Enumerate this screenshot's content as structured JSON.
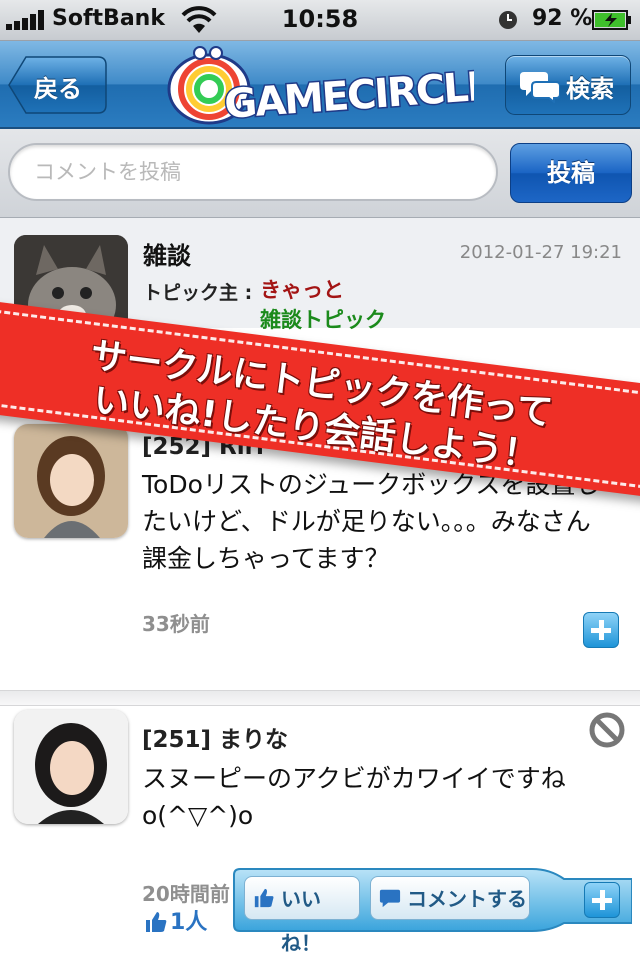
{
  "status_bar": {
    "carrier": "SoftBank",
    "time": "10:58",
    "battery": "92 %"
  },
  "nav": {
    "back_label": "戻る",
    "logo_text": "GAMECIRCLE",
    "search_label": "検索"
  },
  "composer": {
    "placeholder": "コメントを投稿",
    "post_label": "投稿"
  },
  "topic": {
    "title": "雑談",
    "date": "2012-01-27 19:21",
    "owner_label": "トピック主 :",
    "owner": "きゃっと",
    "category_suffix": ": 雑談トピック",
    "category": "雑談トピック"
  },
  "banner": {
    "line1": "サークルにトピックを作って",
    "line2": "いいね!したり会話しよう！"
  },
  "posts": [
    {
      "name": "[252] Riri",
      "body": "ToDoリストのジュークボックスを設置したいけど、ドルが足りない。。。みなさん課金しちゃってます？",
      "time": "33秒前"
    },
    {
      "name": "[251] まりな",
      "body": "スヌーピーのアクビがカワイイですねo(^▽^)o",
      "time": "20時間前",
      "likes": "1人"
    }
  ],
  "actions": {
    "like_label": "いいね！",
    "comment_label": "コメントする"
  },
  "colors": {
    "nav_blue": "#2b7cc0",
    "banner_red": "#ee2f26",
    "owner_red": "#a31414",
    "category_green": "#1b8a1b"
  }
}
